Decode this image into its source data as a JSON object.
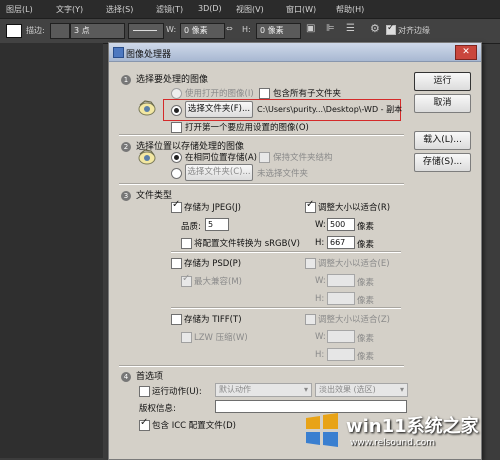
{
  "menubar": {
    "items": [
      "图层(L)",
      "文字(Y)",
      "选择(S)",
      "滤镜(T)",
      "3D(D)",
      "视图(V)",
      "窗口(W)",
      "帮助(H)"
    ]
  },
  "options_bar": {
    "feather_label": "描边:",
    "stroke_width": "3 点",
    "w_label": "W:",
    "w_value": "0 像素",
    "h_label": "H:",
    "h_value": "0 像素",
    "align_edges": "对齐边缘"
  },
  "dialog": {
    "title": "图像处理器",
    "buttons": {
      "run": "运行",
      "cancel": "取消",
      "load": "载入(L)...",
      "save": "存储(S)..."
    },
    "section1": {
      "number": "1",
      "title": "选择要处理的图像",
      "use_open": "使用打开的图像(I)",
      "include_subfolders": "包含所有子文件夹",
      "select_folder": "选择文件夹(F)...",
      "folder_path": "C:\\Users\\purity...\\Desktop\\-WD - 副本",
      "open_first": "打开第一个要应用设置的图像(O)"
    },
    "section2": {
      "number": "2",
      "title": "选择位置以存储处理的图像",
      "same_location": "在相同位置存储(A)",
      "keep_structure": "保持文件夹结构",
      "select_folder": "选择文件夹(C)...",
      "not_selected": "未选择文件夹"
    },
    "section3": {
      "number": "3",
      "title": "文件类型",
      "jpeg": "存储为 JPEG(J)",
      "quality_label": "品质:",
      "quality_value": "5",
      "convert_srgb": "将配置文件转换为 sRGB(V)",
      "resize_jpeg": "调整大小以适合(R)",
      "w_label": "W:",
      "w_value": "500",
      "h_label": "H:",
      "h_value": "667",
      "px": "像素",
      "psd": "存储为 PSD(P)",
      "max_compat": "最大兼容(M)",
      "resize_psd": "调整大小以适合(E)",
      "tiff": "存储为 TIFF(T)",
      "lzw": "LZW 压缩(W)",
      "resize_tiff": "调整大小以适合(Z)"
    },
    "section4": {
      "number": "4",
      "title": "首选项",
      "run_action": "运行动作(U):",
      "action_set": "默认动作",
      "action_name": "淡出效果 (选区)",
      "copyright": "版权信息:",
      "copyright_value": "",
      "include_icc": "包含 ICC 配置文件(D)"
    }
  },
  "watermark": {
    "brand": "win11系统之家",
    "url": "www.relsound.com"
  }
}
